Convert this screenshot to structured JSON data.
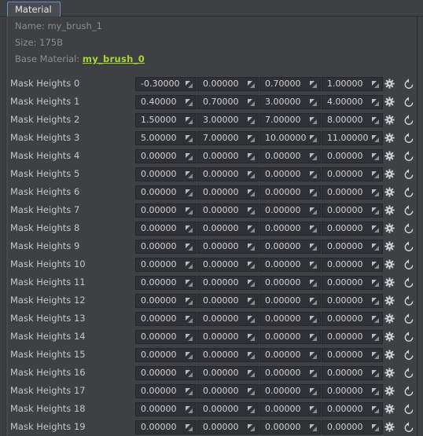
{
  "window": {
    "accent_blue": "#5a8fd0",
    "background": "#3f4044",
    "link_color": "#a6d930"
  },
  "tabs": [
    {
      "label": "Material",
      "active": true
    }
  ],
  "details": {
    "name_label": "Name:",
    "name_value": "my_brush_1",
    "size_label": "Size:",
    "size_value": "175B",
    "base_material_label": "Base Material:",
    "base_material_value": "my_brush_0"
  },
  "icons": {
    "settings": "gear-icon",
    "reset": "reset-arrow-icon",
    "spinner": "drag-spinner-icon"
  },
  "rows": [
    {
      "label": "Mask Heights 0",
      "values": [
        "-0.30000",
        "0.00000",
        "0.70000",
        "1.00000"
      ]
    },
    {
      "label": "Mask Heights 1",
      "values": [
        "0.40000",
        "0.70000",
        "3.00000",
        "4.00000"
      ]
    },
    {
      "label": "Mask Heights 2",
      "values": [
        "1.50000",
        "3.00000",
        "7.00000",
        "8.00000"
      ]
    },
    {
      "label": "Mask Heights 3",
      "values": [
        "5.00000",
        "7.00000",
        "10.00000",
        "11.00000"
      ]
    },
    {
      "label": "Mask Heights 4",
      "values": [
        "0.00000",
        "0.00000",
        "0.00000",
        "0.00000"
      ]
    },
    {
      "label": "Mask Heights 5",
      "values": [
        "0.00000",
        "0.00000",
        "0.00000",
        "0.00000"
      ]
    },
    {
      "label": "Mask Heights 6",
      "values": [
        "0.00000",
        "0.00000",
        "0.00000",
        "0.00000"
      ]
    },
    {
      "label": "Mask Heights 7",
      "values": [
        "0.00000",
        "0.00000",
        "0.00000",
        "0.00000"
      ]
    },
    {
      "label": "Mask Heights 8",
      "values": [
        "0.00000",
        "0.00000",
        "0.00000",
        "0.00000"
      ]
    },
    {
      "label": "Mask Heights 9",
      "values": [
        "0.00000",
        "0.00000",
        "0.00000",
        "0.00000"
      ]
    },
    {
      "label": "Mask Heights 10",
      "values": [
        "0.00000",
        "0.00000",
        "0.00000",
        "0.00000"
      ]
    },
    {
      "label": "Mask Heights 11",
      "values": [
        "0.00000",
        "0.00000",
        "0.00000",
        "0.00000"
      ]
    },
    {
      "label": "Mask Heights 12",
      "values": [
        "0.00000",
        "0.00000",
        "0.00000",
        "0.00000"
      ]
    },
    {
      "label": "Mask Heights 13",
      "values": [
        "0.00000",
        "0.00000",
        "0.00000",
        "0.00000"
      ]
    },
    {
      "label": "Mask Heights 14",
      "values": [
        "0.00000",
        "0.00000",
        "0.00000",
        "0.00000"
      ]
    },
    {
      "label": "Mask Heights 15",
      "values": [
        "0.00000",
        "0.00000",
        "0.00000",
        "0.00000"
      ]
    },
    {
      "label": "Mask Heights 16",
      "values": [
        "0.00000",
        "0.00000",
        "0.00000",
        "0.00000"
      ]
    },
    {
      "label": "Mask Heights 17",
      "values": [
        "0.00000",
        "0.00000",
        "0.00000",
        "0.00000"
      ]
    },
    {
      "label": "Mask Heights 18",
      "values": [
        "0.00000",
        "0.00000",
        "0.00000",
        "0.00000"
      ]
    },
    {
      "label": "Mask Heights 19",
      "values": [
        "0.00000",
        "0.00000",
        "0.00000",
        "0.00000"
      ]
    }
  ]
}
